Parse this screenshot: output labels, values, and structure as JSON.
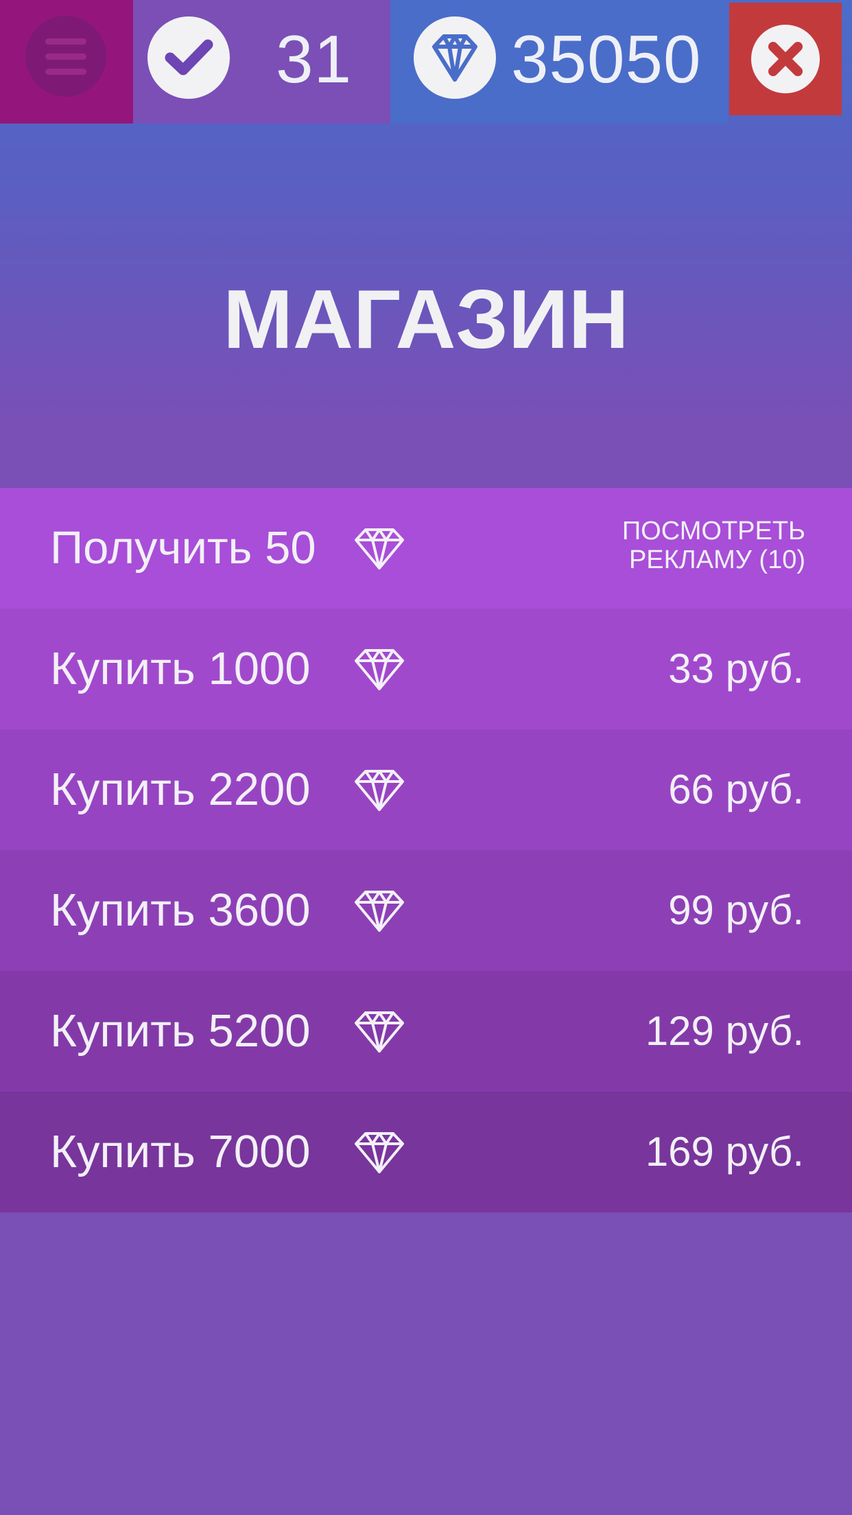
{
  "topbar": {
    "score": "31",
    "gems": "35050"
  },
  "title": "МАГАЗИН",
  "shop": {
    "items": [
      {
        "label": "Получить 50",
        "ad_line1": "ПОСМОТРЕТЬ",
        "ad_line2": "РЕКЛАМУ (10)",
        "bg": "#a84ed8"
      },
      {
        "label": "Купить 1000",
        "price": "33 руб.",
        "bg": "#a149cd"
      },
      {
        "label": "Купить 2200",
        "price": "66 руб.",
        "bg": "#9744c2"
      },
      {
        "label": "Купить 3600",
        "price": "99 руб.",
        "bg": "#8d40b6"
      },
      {
        "label": "Купить 5200",
        "price": "129 руб.",
        "bg": "#833aa8"
      },
      {
        "label": "Купить 7000",
        "price": "169 руб.",
        "bg": "#78359c"
      }
    ]
  },
  "colors": {
    "menu_bg": "#94167c",
    "score_bg": "#7b4fb6",
    "gems_bg": "#4a6dc9",
    "close_bg": "#c33a3d"
  },
  "icons": [
    "menu-icon",
    "checkmark-icon",
    "diamond-icon",
    "close-icon"
  ]
}
